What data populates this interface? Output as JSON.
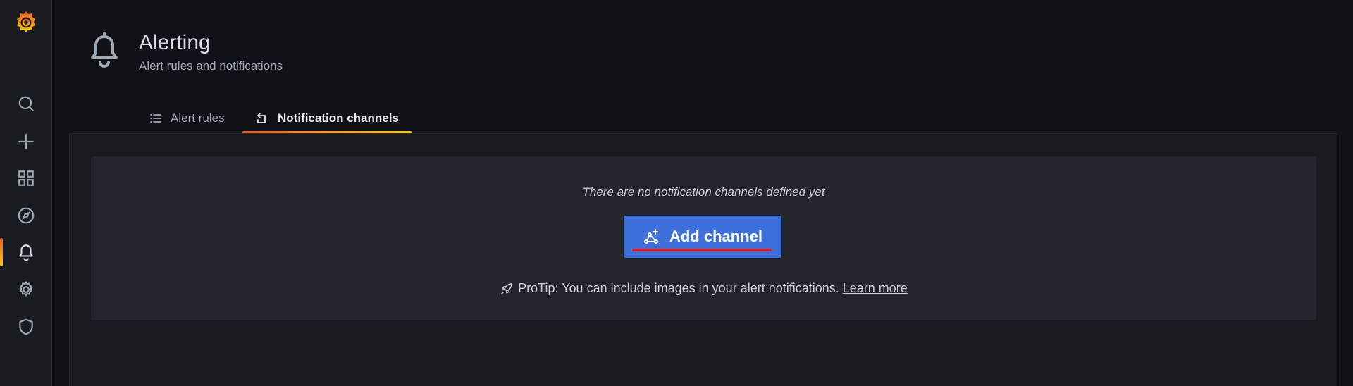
{
  "colors": {
    "background": "#111217",
    "sidebar": "#181b1f",
    "panel": "#22252b",
    "primary_button": "#3d71d9",
    "active_gradient_start": "#f05a28",
    "active_gradient_end": "#fbca0a",
    "annotation_underline": "#e0151e"
  },
  "sidebar": {
    "logo_icon": "grafana-logo-icon",
    "items": [
      {
        "icon": "search-icon",
        "active": false
      },
      {
        "icon": "plus-icon",
        "active": false
      },
      {
        "icon": "dashboards-grid-icon",
        "active": false
      },
      {
        "icon": "compass-icon",
        "active": false
      },
      {
        "icon": "bell-icon",
        "active": true
      },
      {
        "icon": "gear-icon",
        "active": false
      },
      {
        "icon": "shield-icon",
        "active": false
      }
    ]
  },
  "header": {
    "icon": "bell-icon",
    "title": "Alerting",
    "subtitle": "Alert rules and notifications"
  },
  "tabs": [
    {
      "label": "Alert rules",
      "icon": "list-icon",
      "active": false
    },
    {
      "label": "Notification channels",
      "icon": "channel-arrow-icon",
      "active": true
    }
  ],
  "main": {
    "empty_message": "There are no notification channels defined yet",
    "add_button_label": "Add channel",
    "add_button_icon": "channel-add-icon",
    "protip_icon": "rocket-icon",
    "protip_text": "ProTip: You can include images in your alert notifications.",
    "learn_more_label": "Learn more"
  }
}
